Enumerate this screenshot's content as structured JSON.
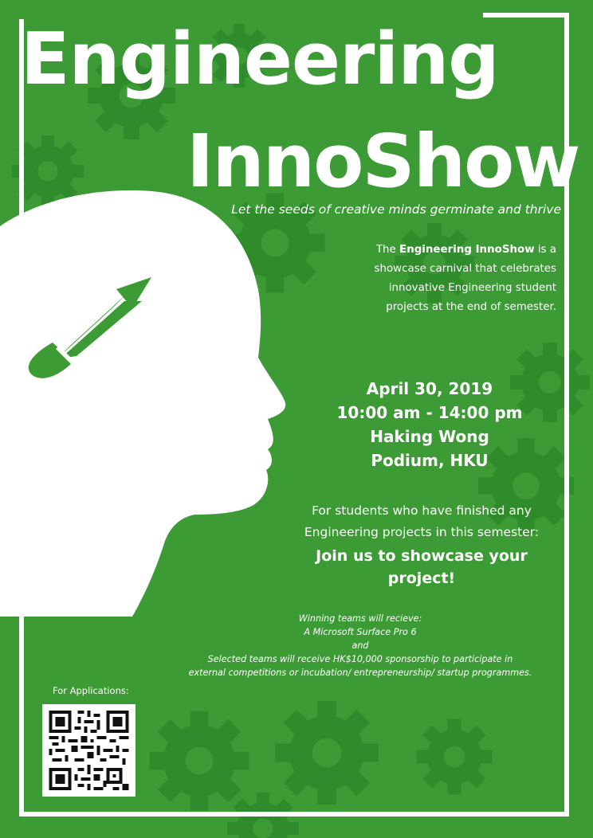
{
  "colors": {
    "background": "#3d9b35",
    "gear": "#2e8a2a",
    "text": "#ffffff",
    "pencil": "#3d9b35"
  },
  "title": {
    "line1": "Engineering",
    "line2": "InnoShow"
  },
  "tagline": "Let the seeds of creative minds germinate and thrive",
  "intro": {
    "prefix": "The ",
    "bold": "Engineering InnoShow",
    "suffix": " is a showcase carnival that celebrates  innovative Engineering student projects at the end of semester."
  },
  "event": {
    "date": "April 30, 2019",
    "time": "10:00 am - 14:00 pm",
    "venue_line1": "Haking Wong",
    "venue_line2": "Podium, HKU"
  },
  "call_to_action": {
    "lead": "For students who have finished any Engineering projects in this semester:",
    "headline": "Join us to showcase your project!"
  },
  "prizes": {
    "line1": "Winning teams will recieve:",
    "line2": "A Microsoft Surface Pro 6",
    "line3": "and",
    "line4": "Selected teams will receive HK$10,000 sponsorship to participate in",
    "line5": "external competitions or incubation/ entrepreneurship/ startup programmes."
  },
  "applications": {
    "label": "For Applications:",
    "qr_icon": "qr-code-icon"
  },
  "illustration": {
    "head_icon": "head-silhouette-icon",
    "pencil_icon": "pencil-icon",
    "gear_icon": "gear-icon"
  }
}
